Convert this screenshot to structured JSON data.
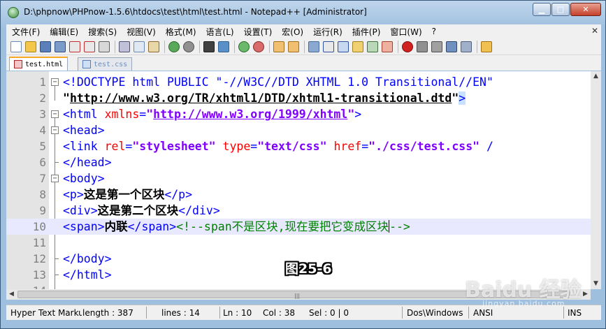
{
  "window": {
    "title": "D:\\phpnow\\PHPnow-1.5.6\\htdocs\\test\\html\\test.html - Notepad++ [Administrator]",
    "buttons": {
      "minimize": "▁",
      "maximize": "□",
      "close": "✕"
    }
  },
  "menubar": {
    "items": [
      "文件(F)",
      "编辑(E)",
      "搜索(S)",
      "视图(V)",
      "格式(M)",
      "语言(L)",
      "设置(T)",
      "宏(O)",
      "运行(R)",
      "插件(P)",
      "窗口(W)",
      "?"
    ],
    "close_glyph": "✕"
  },
  "toolbar": {
    "icons": [
      "new-file-icon",
      "open-file-icon",
      "save-icon",
      "save-all-icon",
      "close-icon",
      "close-all-icon",
      "print-icon",
      "cut-icon",
      "copy-icon",
      "paste-icon",
      "undo-icon",
      "redo-icon",
      "find-icon",
      "replace-icon",
      "zoom-in-icon",
      "zoom-out-icon",
      "sync-v-icon",
      "sync-h-icon",
      "wrap-icon",
      "all-chars-icon",
      "indent-guide-icon",
      "lang-icon",
      "map-icon",
      "func-list-icon",
      "record-icon",
      "stop-icon",
      "play-icon",
      "play-multi-icon",
      "save-macro-icon",
      "run-icon"
    ]
  },
  "tabs": [
    {
      "label": "test.html",
      "active": true
    },
    {
      "label": "test.css",
      "active": false
    }
  ],
  "editor": {
    "line_numbers": [
      "1",
      "2",
      "3",
      "4",
      "5",
      "6",
      "7",
      "8",
      "9",
      "10",
      "11",
      "12",
      "13",
      "14"
    ],
    "lines": {
      "l1": {
        "a": "<!DOCTYPE html PUBLIC \"-//W3C//DTD XHTML 1.0 Transitional//EN\""
      },
      "l2": {
        "a": "\"",
        "b": "http://www.w3.org/TR/xhtml1/DTD/xhtml1-transitional.dtd",
        "c": "\"",
        "d": ">"
      },
      "l3": {
        "a": "<html",
        "b": " xmlns",
        "c": "=",
        "d": "\"",
        "e": "http://www.w3.org/1999/xhtml",
        "f": "\"",
        "g": ">"
      },
      "l4": {
        "a": "<head>"
      },
      "l5": {
        "a": "<link",
        "b": " rel",
        "c": "=",
        "d": "\"stylesheet\"",
        "e": " type",
        "f": "=",
        "g": "\"text/css\"",
        "h": " href",
        "i": "=",
        "j": "\"./css/test.css\"",
        "k": " /"
      },
      "l6": {
        "a": "</head>"
      },
      "l7": {
        "a": "<body>"
      },
      "l8": {
        "a": "<p>",
        "b": "这是第一个区块",
        "c": "</p>"
      },
      "l9": {
        "a": "<div>",
        "b": "这是第二个区块",
        "c": "</div>"
      },
      "l10": {
        "a": "<span>",
        "b": "内联",
        "c": "</span>",
        "d": "<!--span不是区块,现在要把它变成区块",
        "e": "-->"
      },
      "l11": {
        "a": ""
      },
      "l12": {
        "a": "</body>"
      },
      "l13": {
        "a": "</html>"
      },
      "l14": {
        "a": ""
      }
    },
    "current_line": 10
  },
  "statusbar": {
    "file_type": "Hyper Text Marku",
    "length": "length : 387",
    "lines": "lines : 14",
    "ln": "Ln : 10",
    "col": "Col : 38",
    "sel": "Sel : 0 | 0",
    "eol": "Dos\\Windows",
    "encoding": "ANSI",
    "mode": "INS"
  },
  "overlay": {
    "figure_label": "图25-6",
    "watermark": "Baidu 经验",
    "watermark_sub": "jingyan.baidu.com"
  }
}
